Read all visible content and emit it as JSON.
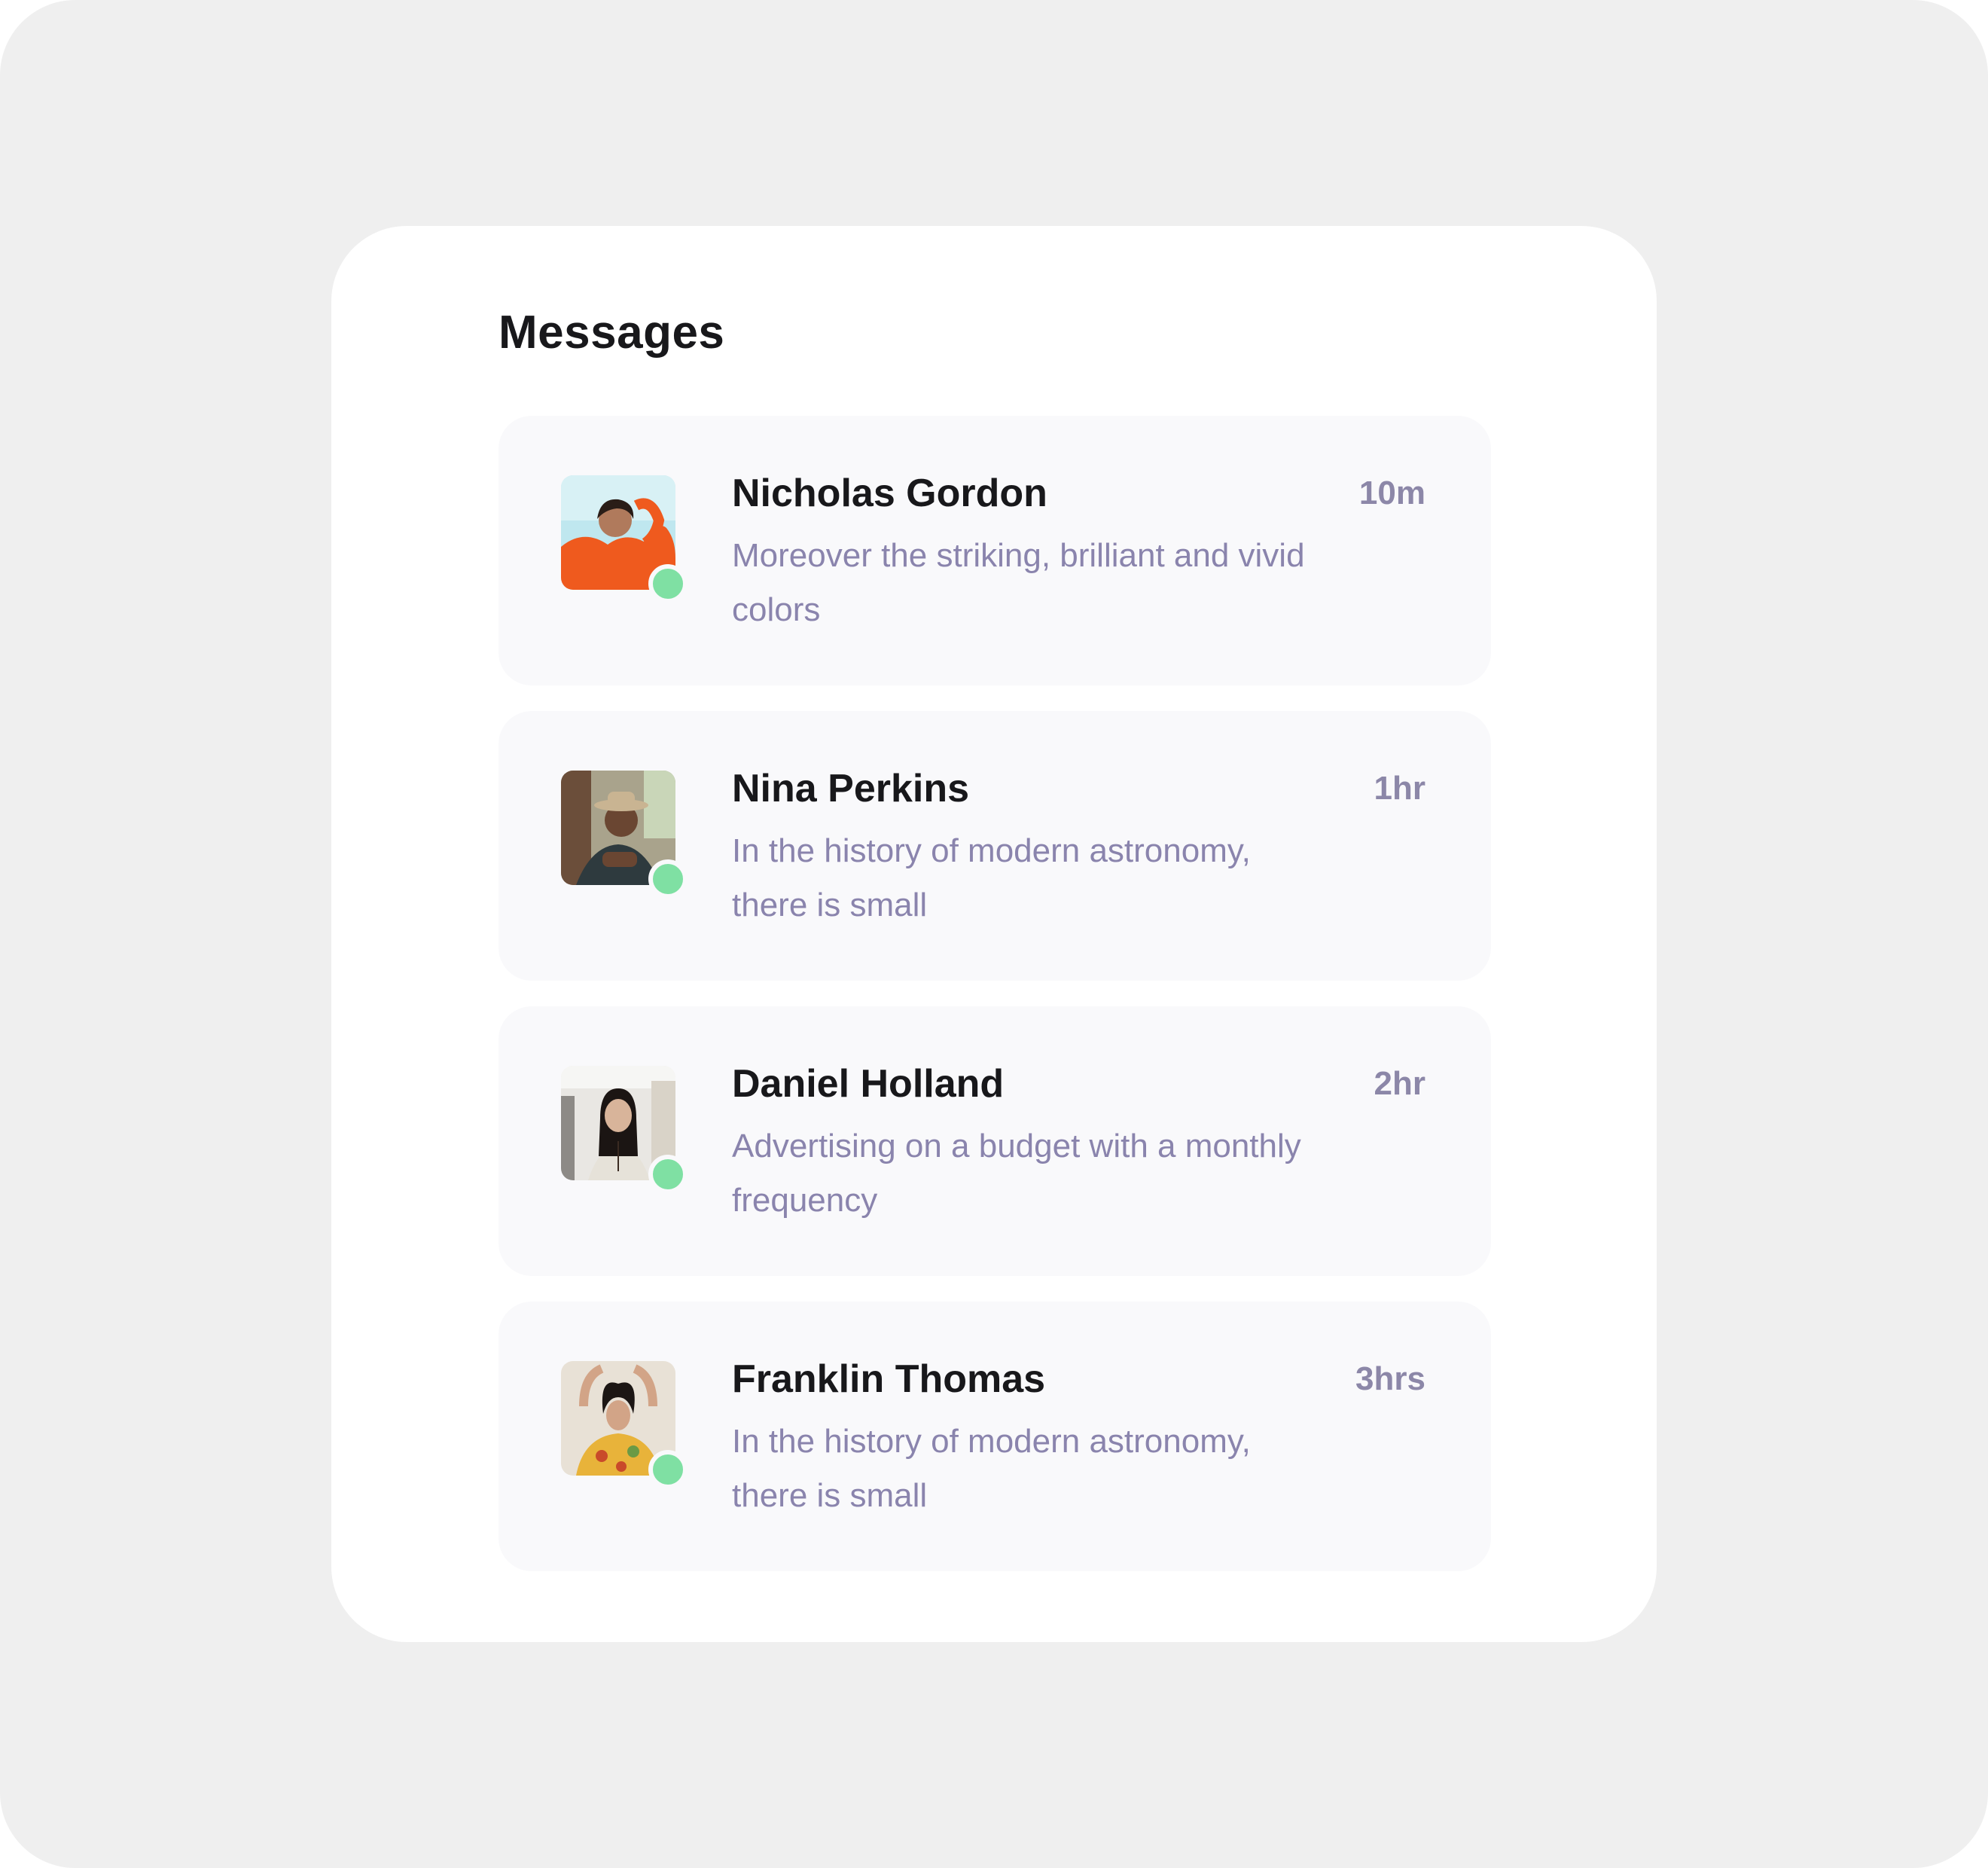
{
  "header": {
    "title": "Messages"
  },
  "status_color": "#7fe0a3",
  "messages": [
    {
      "name": "Nicholas Gordon",
      "time": "10m",
      "preview": "Moreover the striking, brilliant and vivid colors",
      "avatar_icon": "avatar-photo",
      "online": true
    },
    {
      "name": "Nina Perkins",
      "time": "1hr",
      "preview": "In the history of modern astronomy, there is small",
      "avatar_icon": "avatar-photo",
      "online": true
    },
    {
      "name": "Daniel Holland",
      "time": "2hr",
      "preview": "Advertising on a budget with a monthly frequency",
      "avatar_icon": "avatar-photo",
      "online": true
    },
    {
      "name": "Franklin Thomas",
      "time": "3hrs",
      "preview": "In the history of modern astronomy, there is small",
      "avatar_icon": "avatar-photo",
      "online": true
    }
  ]
}
